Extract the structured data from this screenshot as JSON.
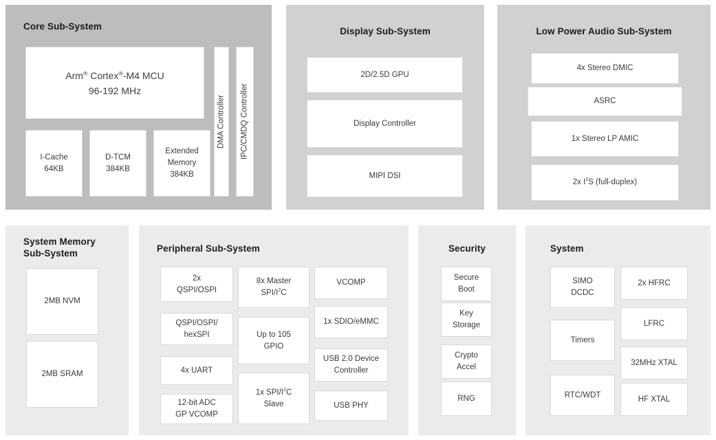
{
  "colors": {
    "page_background": "#ffffff",
    "panel_dark": "#bdbdbd",
    "panel_mid": "#d1d1d1",
    "panel_light": "#ebebeb",
    "block_fill": "#ffffff",
    "block_border": "#d9d9d9",
    "title_text": "#1c1c1c",
    "block_text": "#3a3a3a"
  },
  "panels": {
    "core": {
      "title": "Core Sub-System",
      "blocks": {
        "mcu": "Arm® Cortex®-M4 MCU\n96-192 MHz",
        "icache": "I-Cache\n64KB",
        "dtcm": "D-TCM\n384KB",
        "extmem": "Extended\nMemory\n384KB",
        "dma": "DMA Controller",
        "ipc": "IPC/CMDQ Controller"
      }
    },
    "display": {
      "title": "Display Sub-System",
      "blocks": {
        "gpu": "2D/2.5D GPU",
        "display_controller": "Display Controller",
        "mipi_dsi": "MIPI DSI"
      }
    },
    "audio": {
      "title": "Low Power Audio Sub-System",
      "blocks": {
        "dmic": "4x Stereo DMIC",
        "asrc": "ASRC",
        "amic": "1x Stereo LP AMIC",
        "i2s": "2x I²S (full-duplex)"
      }
    },
    "memory": {
      "title": "System Memory\nSub-System",
      "blocks": {
        "nvm": "2MB NVM",
        "sram": "2MB SRAM"
      }
    },
    "peripheral": {
      "title": "Peripheral Sub-System",
      "blocks": {
        "qspi_ospi": "2x\nQSPI/OSPI",
        "hexspi": "QSPI/OSPI/\nhexSPI",
        "uart": "4x UART",
        "adc": "12-bit ADC\nGP VCOMP",
        "master_spi": "8x Master\nSPI/I²C",
        "gpio": "Up to 105\nGPIO",
        "slave_spi": "1x SPI/I²C\nSlave",
        "vcomp": "VCOMP",
        "sdio": "1x SDIO/eMMC",
        "usb_device": "USB 2.0 Device\nController",
        "usb_phy": "USB PHY"
      }
    },
    "security": {
      "title": "Security",
      "blocks": {
        "secure_boot": "Secure\nBoot",
        "key_storage": "Key\nStorage",
        "crypto": "Crypto\nAccel",
        "rng": "RNG"
      }
    },
    "system": {
      "title": "System",
      "blocks": {
        "simo": "SIMO\nDCDC",
        "timers": "Timers",
        "rtc_wdt": "RTC/WDT",
        "hfrc": "2x HFRC",
        "lfrc": "LFRC",
        "xtal_32": "32MHz XTAL",
        "xtal_hf": "HF XTAL"
      }
    }
  }
}
